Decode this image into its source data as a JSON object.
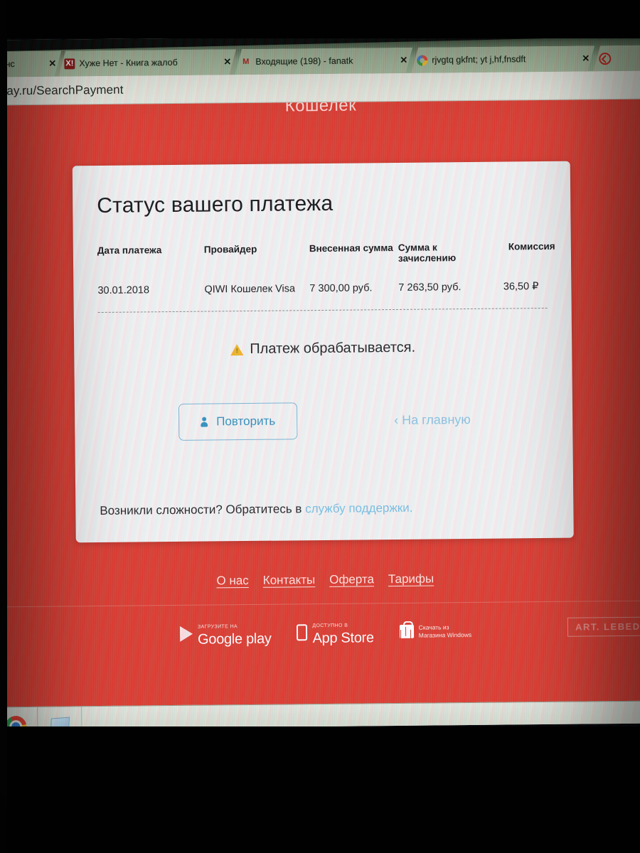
{
  "browser": {
    "tabs": [
      {
        "label": "ал Темнс",
        "favicon": "generic-icon",
        "close_label": "✕"
      },
      {
        "label": "Хуже Нет - Книга жалоб",
        "favicon": "x-red-icon",
        "favicon_text": "X!",
        "close_label": "✕"
      },
      {
        "label": "Входящие (198) - fanatk",
        "favicon": "gmail-icon",
        "favicon_text": "M",
        "close_label": "✕"
      },
      {
        "label": "rjvgtq gkfnt; yt j,hf,fnsdft",
        "favicon": "google-icon",
        "close_label": "✕"
      },
      {
        "label": "",
        "favicon": "opera-icon",
        "close_label": ""
      }
    ],
    "url": "nepay.ru/SearchPayment"
  },
  "page": {
    "header_title": "Кошелек",
    "card": {
      "title": "Статус вашего платежа",
      "table": {
        "headers": [
          "Дата платежа",
          "Провайдер",
          "Внесенная сумма",
          "Сумма к зачислению",
          "Комиссия"
        ],
        "rows": [
          {
            "date": "30.01.2018",
            "provider": "QIWI Кошелек Visa",
            "paid": "7 300,00 руб.",
            "credited": "7 263,50 руб.",
            "fee": "36,50 ₽"
          }
        ]
      },
      "status": {
        "icon": "warning-triangle-icon",
        "text": "Платеж обрабатывается."
      },
      "actions": {
        "repeat_button": "Повторить",
        "repeat_icon": "user-add-icon",
        "home_link": "‹ На главную"
      },
      "support": {
        "prefix": "Возникли сложности? Обратитесь в ",
        "link": "службу поддержки."
      }
    },
    "footer": {
      "nav": [
        "О нас",
        "Контакты",
        "Оферта",
        "Тарифы"
      ],
      "stores": [
        {
          "icon": "google-play-icon",
          "top": "ЗАГРУЗИТЕ НА",
          "main": "Google play"
        },
        {
          "icon": "app-store-icon",
          "top": "Доступно в",
          "main": "App Store"
        },
        {
          "icon": "windows-store-icon",
          "line1": "Скачать из",
          "line2": "Магазина Windows"
        }
      ],
      "credit": "ART. LEBEDEV"
    }
  },
  "taskbar": {
    "items": [
      {
        "icon": "chrome-icon"
      },
      {
        "icon": "notepad-icon"
      }
    ]
  },
  "colors": {
    "page_red": "#dd4133",
    "card_bg": "#f3f2f0",
    "accent_blue": "#3a93bd",
    "link_blue": "#8fc4e0",
    "warning_amber": "#f0b72a"
  }
}
